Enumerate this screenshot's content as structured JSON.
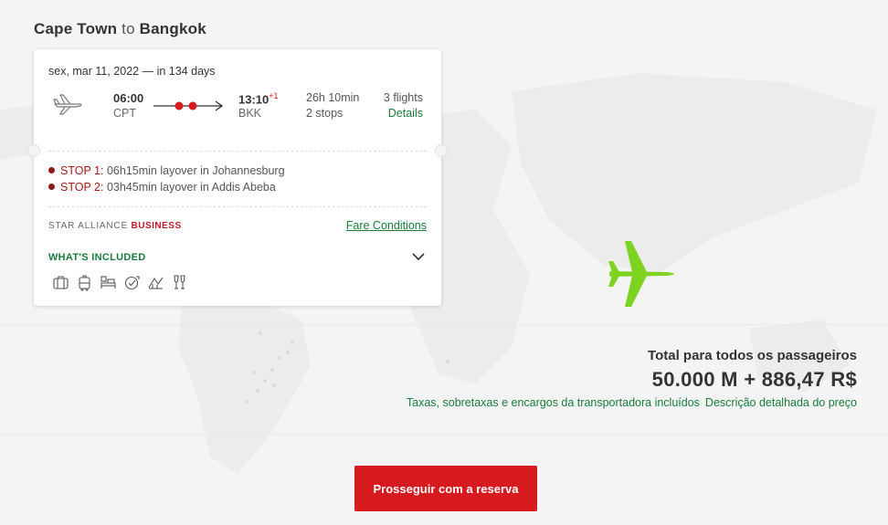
{
  "route": {
    "origin": "Cape Town",
    "connector": "to",
    "destination": "Bangkok"
  },
  "flight": {
    "date": "sex, mar 11, 2022",
    "days_away": "— in 134 days",
    "departure_time": "06:00",
    "departure_code": "CPT",
    "arrival_time": "13:10",
    "arrival_day_offset": "+1",
    "arrival_code": "BKK",
    "duration": "26h 10min",
    "stops_count": "2 stops",
    "flights_count": "3 flights",
    "details_label": "Details"
  },
  "stops": [
    {
      "label": "STOP 1:",
      "text": "06h15min layover in Johannesburg"
    },
    {
      "label": "STOP 2:",
      "text": "03h45min layover in Addis Abeba"
    }
  ],
  "cabin": {
    "alliance": "STAR ALLIANCE",
    "class": "BUSINESS"
  },
  "fare_conditions_label": "Fare Conditions",
  "whats_included_label": "WHAT'S INCLUDED",
  "amenity_icons": [
    "baggage-icon",
    "carry-on-icon",
    "lounge-icon",
    "priority-icon",
    "meal-icon",
    "champagne-icon"
  ],
  "total": {
    "label": "Total para todos os passageiros",
    "value": "50.000 M + 886,47 R$",
    "taxes_note": "Taxas, sobretaxas e encargos da transportadora incluídos",
    "price_breakdown_link": "Descrição detalhada do preço"
  },
  "proceed_button": "Prosseguir com a reserva",
  "colors": {
    "brand_red": "#d71920",
    "link_green": "#1a7a3c",
    "plane_green": "#7ed321"
  }
}
